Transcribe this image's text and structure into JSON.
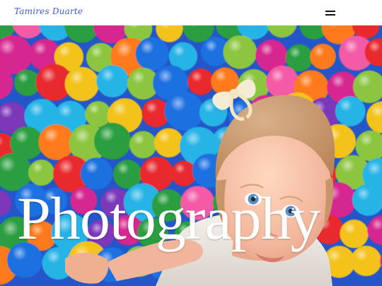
{
  "header": {
    "brand": "Tamires Duarte",
    "menu_icon": "hamburger-menu-icon"
  },
  "hero": {
    "title": "Photography",
    "image": "baby-in-ball-pit-photo"
  },
  "colors": {
    "brand": "#3f59d6",
    "title": "#ffffff",
    "header_bg": "#ffffff"
  }
}
